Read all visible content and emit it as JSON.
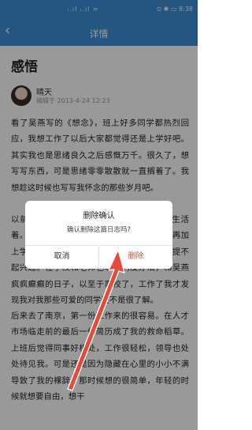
{
  "status_bar": {
    "signal": "ᵢ.ıl ᵢ.ıl ≈",
    "icons_right": "⊙ ✱ ▭ 8:38"
  },
  "header": {
    "title": "详情",
    "back_icon": "chevron-left"
  },
  "article": {
    "title": "感悟",
    "author": "晴天",
    "edited": "编辑于 2013-4-24 12:23",
    "paragraphs": [
      "看了吴燕写的《想念》，班上好多同学都热烈回应，我想工作了以后大家都觉得还是上学好吧。其实我也是思绪良久之后感慨万千。很久了，想写写东西，可是思绪零零散散就一直搁着了。我想趁这时候也写写我怀念的那些岁月吧。",
      "以前在学校的日子，同学们在一起快乐地生活着。东西，想，那时候大家不珍惜，有的人再加上学校里原本就很自由很散漫的环境，总是提不起兴趣。在学校和老师也拿我们没办法，和吴燕疯疯癫癫的日子，以至于离校了，工作了我才发现我对我那些可爱的同学还不是很了解。",
      "后来去了南京，第一份工作来的很容易。在人才市场临走前的最后一份简历成了我的救命稻草。上班后觉得同事好相处，工作很轻松，领导也处处待见我。可是还是因为隐藏在心里的小小不满导致了我的裸辞。那时候想的很简单，年轻的时候就想要自由，想干"
    ]
  },
  "dialog": {
    "title": "删除确认",
    "message": "确认删除这篇日志吗?",
    "cancel_label": "取消",
    "confirm_label": "删除"
  },
  "colors": {
    "header_bg": "#3b8fd6",
    "danger": "#e2543b",
    "arrow": "#e84a3a"
  }
}
